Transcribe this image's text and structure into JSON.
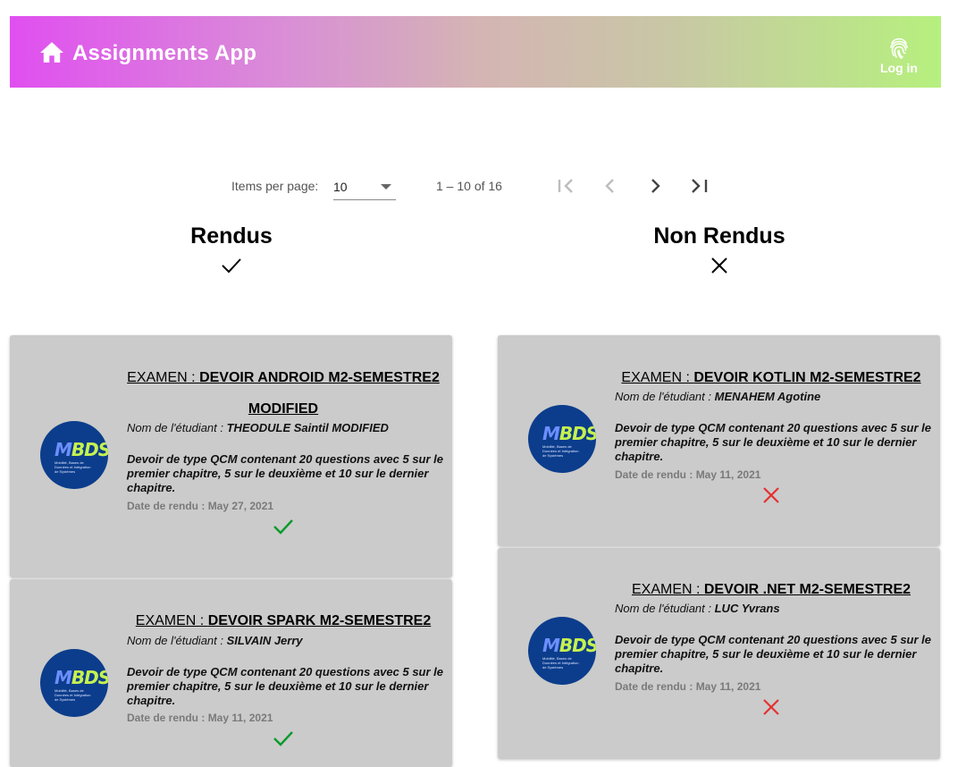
{
  "app": {
    "title": "Assignments App",
    "login_label": "Log in"
  },
  "icons": {
    "home": "home-icon",
    "login": "fingerprint-icon"
  },
  "colors": {
    "rendu_check": "#0a9a2a",
    "non_rendu_x": "#e53030",
    "card_bg": "#cbcbcb"
  },
  "paginator": {
    "items_per_page_label": "Items per page:",
    "page_size": "10",
    "range_label": "1 – 10 of 16"
  },
  "columns": {
    "rendus_title": "Rendus",
    "non_rendus_title": "Non Rendus"
  },
  "labels": {
    "examen_prefix": "EXAMEN : ",
    "student_prefix": "Nom de l'étudiant : ",
    "date_prefix": "Date de rendu : "
  },
  "rendus": [
    {
      "title_line1": "DEVOIR ANDROID M2-SEMESTRE2",
      "title_line2": "MODIFIED",
      "student": "THEODULE Saintil MODIFIED",
      "description": "Devoir de type QCM contenant 20 questions avec 5 sur le premier chapitre, 5 sur le deuxième et 10 sur le dernier chapitre.",
      "date": "May 27, 2021"
    },
    {
      "title_line1": "DEVOIR SPARK M2-SEMESTRE2",
      "student": "SILVAIN Jerry",
      "description": "Devoir de type QCM contenant 20 questions avec 5 sur le premier chapitre, 5 sur le deuxième et 10 sur le dernier chapitre.",
      "date": "May 11, 2021"
    }
  ],
  "non_rendus": [
    {
      "title_line1": "DEVOIR KOTLIN M2-SEMESTRE2",
      "student": "MENAHEM Agotine",
      "description": "Devoir de type QCM contenant 20 questions avec 5 sur le premier chapitre, 5 sur le deuxième et 10 sur le dernier chapitre.",
      "date": "May 11, 2021"
    },
    {
      "title_line1": "DEVOIR .NET M2-SEMESTRE2",
      "student": "LUC Yvrans",
      "description": "Devoir de type QCM contenant 20 questions avec 5 sur le premier chapitre, 5 sur le deuxième et 10 sur le dernier chapitre.",
      "date": "May 11, 2021"
    }
  ],
  "logo": {
    "text_a": "M",
    "text_b": "BDS",
    "caption": "Mobilité, Bases de Données et Intégration de Systèmes"
  }
}
